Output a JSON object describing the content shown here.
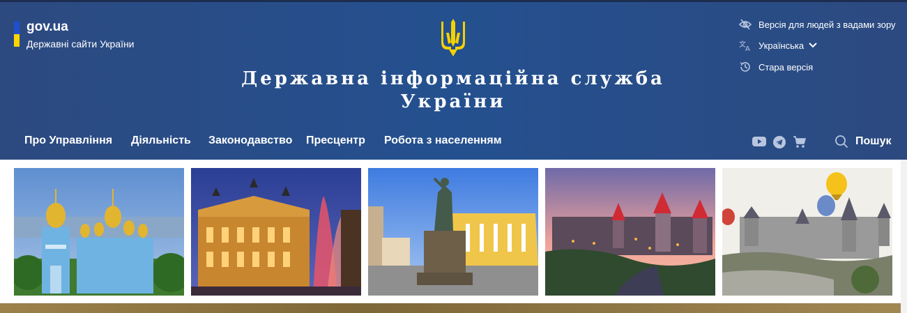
{
  "brand": {
    "name": "gov.ua",
    "subtitle": "Державні сайти України"
  },
  "site_title_line1": "Державна інформаційна служба",
  "site_title_line2": "України",
  "utility": {
    "accessibility": "Версія для людей з вадами зору",
    "language": "Українська",
    "old_version": "Стара версія"
  },
  "nav": {
    "items": [
      {
        "label": "Про Управління"
      },
      {
        "label": "Діяльність"
      },
      {
        "label": "Законодавство"
      },
      {
        "label": "Пресцентр"
      },
      {
        "label": "Робота з населенням"
      }
    ],
    "search_label": "Пошук"
  },
  "icons": [
    "eye-slash-icon",
    "translate-icon",
    "history-icon",
    "chevron-down-icon",
    "youtube-icon",
    "telegram-icon",
    "cart-icon",
    "search-icon",
    "trident-icon"
  ],
  "colors": {
    "header_bg": "#2a4d87",
    "flag_blue": "#1f4fcf",
    "flag_yellow": "#ffd500",
    "trident_gold": "#f5d100"
  },
  "photos": [
    {
      "subject": "Golden-domed monastery"
    },
    {
      "subject": "Opera theatre at night with fountain"
    },
    {
      "subject": "Statue and yellow building"
    },
    {
      "subject": "Fortress at dusk"
    },
    {
      "subject": "Castle with hot air balloons"
    }
  ]
}
